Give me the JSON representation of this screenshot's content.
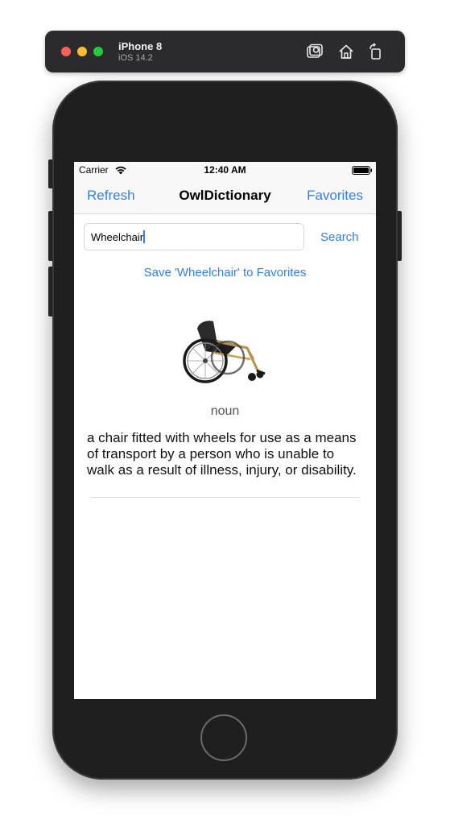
{
  "simulator": {
    "device_name": "iPhone 8",
    "os_version": "iOS 14.2",
    "toolbar_icons": [
      "screenshot-icon",
      "home-icon",
      "rotate-icon"
    ]
  },
  "status_bar": {
    "carrier": "Carrier",
    "time": "12:40 AM"
  },
  "nav": {
    "left_button": "Refresh",
    "title": "OwlDictionary",
    "right_button": "Favorites"
  },
  "search": {
    "value": "Wheelchair",
    "button_label": "Search"
  },
  "save_link": "Save 'Wheelchair' to Favorites",
  "entry": {
    "image_icon": "wheelchair-image",
    "part_of_speech": "noun",
    "definition": "a chair fitted with wheels for use as a means of transport by a person who is unable to walk as a result of illness, injury, or disability."
  },
  "colors": {
    "accent": "#2f7ff0",
    "phone_body": "#1f1f20",
    "nav_background": "#f8f8f8"
  }
}
